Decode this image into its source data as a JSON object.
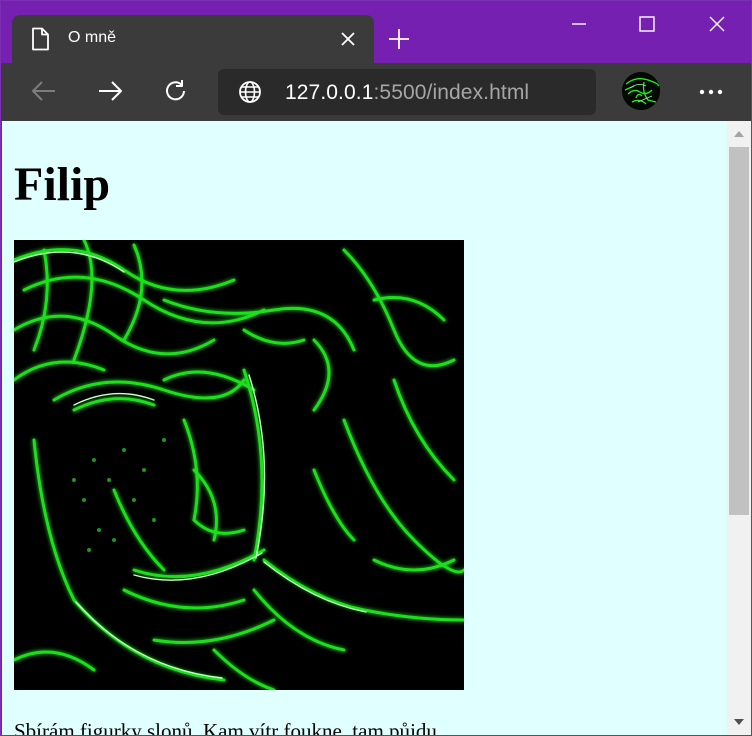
{
  "browser": {
    "tab": {
      "title": "O mně",
      "icon": "document-icon"
    },
    "window_controls": [
      "minimize-icon",
      "maximize-icon",
      "close-icon"
    ],
    "toolbar": {
      "buttons": [
        "back-arrow-icon",
        "forward-arrow-icon",
        "refresh-icon",
        "more-options-icon"
      ],
      "url_host": "127.0.0.1",
      "url_rest": ":5500/index.html"
    },
    "colors": {
      "titlebar": "#7520b0",
      "toolbar": "#3b3b3b",
      "page_background": "#e0ffff",
      "photo_lines": "#22ff22"
    }
  },
  "page": {
    "heading": "Filip",
    "image": "green neon edge-detected portrait photo",
    "paragraph": "Sbírám figurky slonů. Kam vítr foukne, tam půjdu."
  }
}
